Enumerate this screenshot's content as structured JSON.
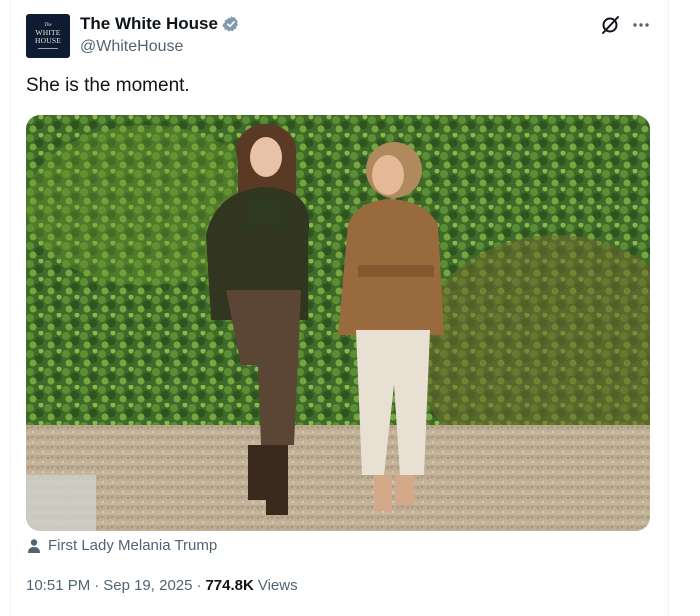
{
  "post": {
    "author": {
      "display_name": "The White House",
      "handle": "@WhiteHouse",
      "avatar_text": {
        "line1": "The",
        "line2": "WHITE",
        "line3": "HOUSE"
      },
      "verified_badge": "verified-icon"
    },
    "text": "She is the moment.",
    "media": {
      "image": "photo of two women walking on a gravel path in front of hedges"
    },
    "media_tag": {
      "icon": "person-icon",
      "label": "First Lady Melania Trump"
    },
    "meta": {
      "time": "10:51 PM",
      "separator": "·",
      "date": "Sep 19, 2025",
      "views_count": "774.8K",
      "views_label": "Views"
    },
    "actions": {
      "grok": "grok-icon",
      "more": "more-icon"
    }
  },
  "colors": {
    "text_primary": "#0f1419",
    "text_secondary": "#536471",
    "verified": "#829aab",
    "avatar_bg": "#0f1b33"
  }
}
